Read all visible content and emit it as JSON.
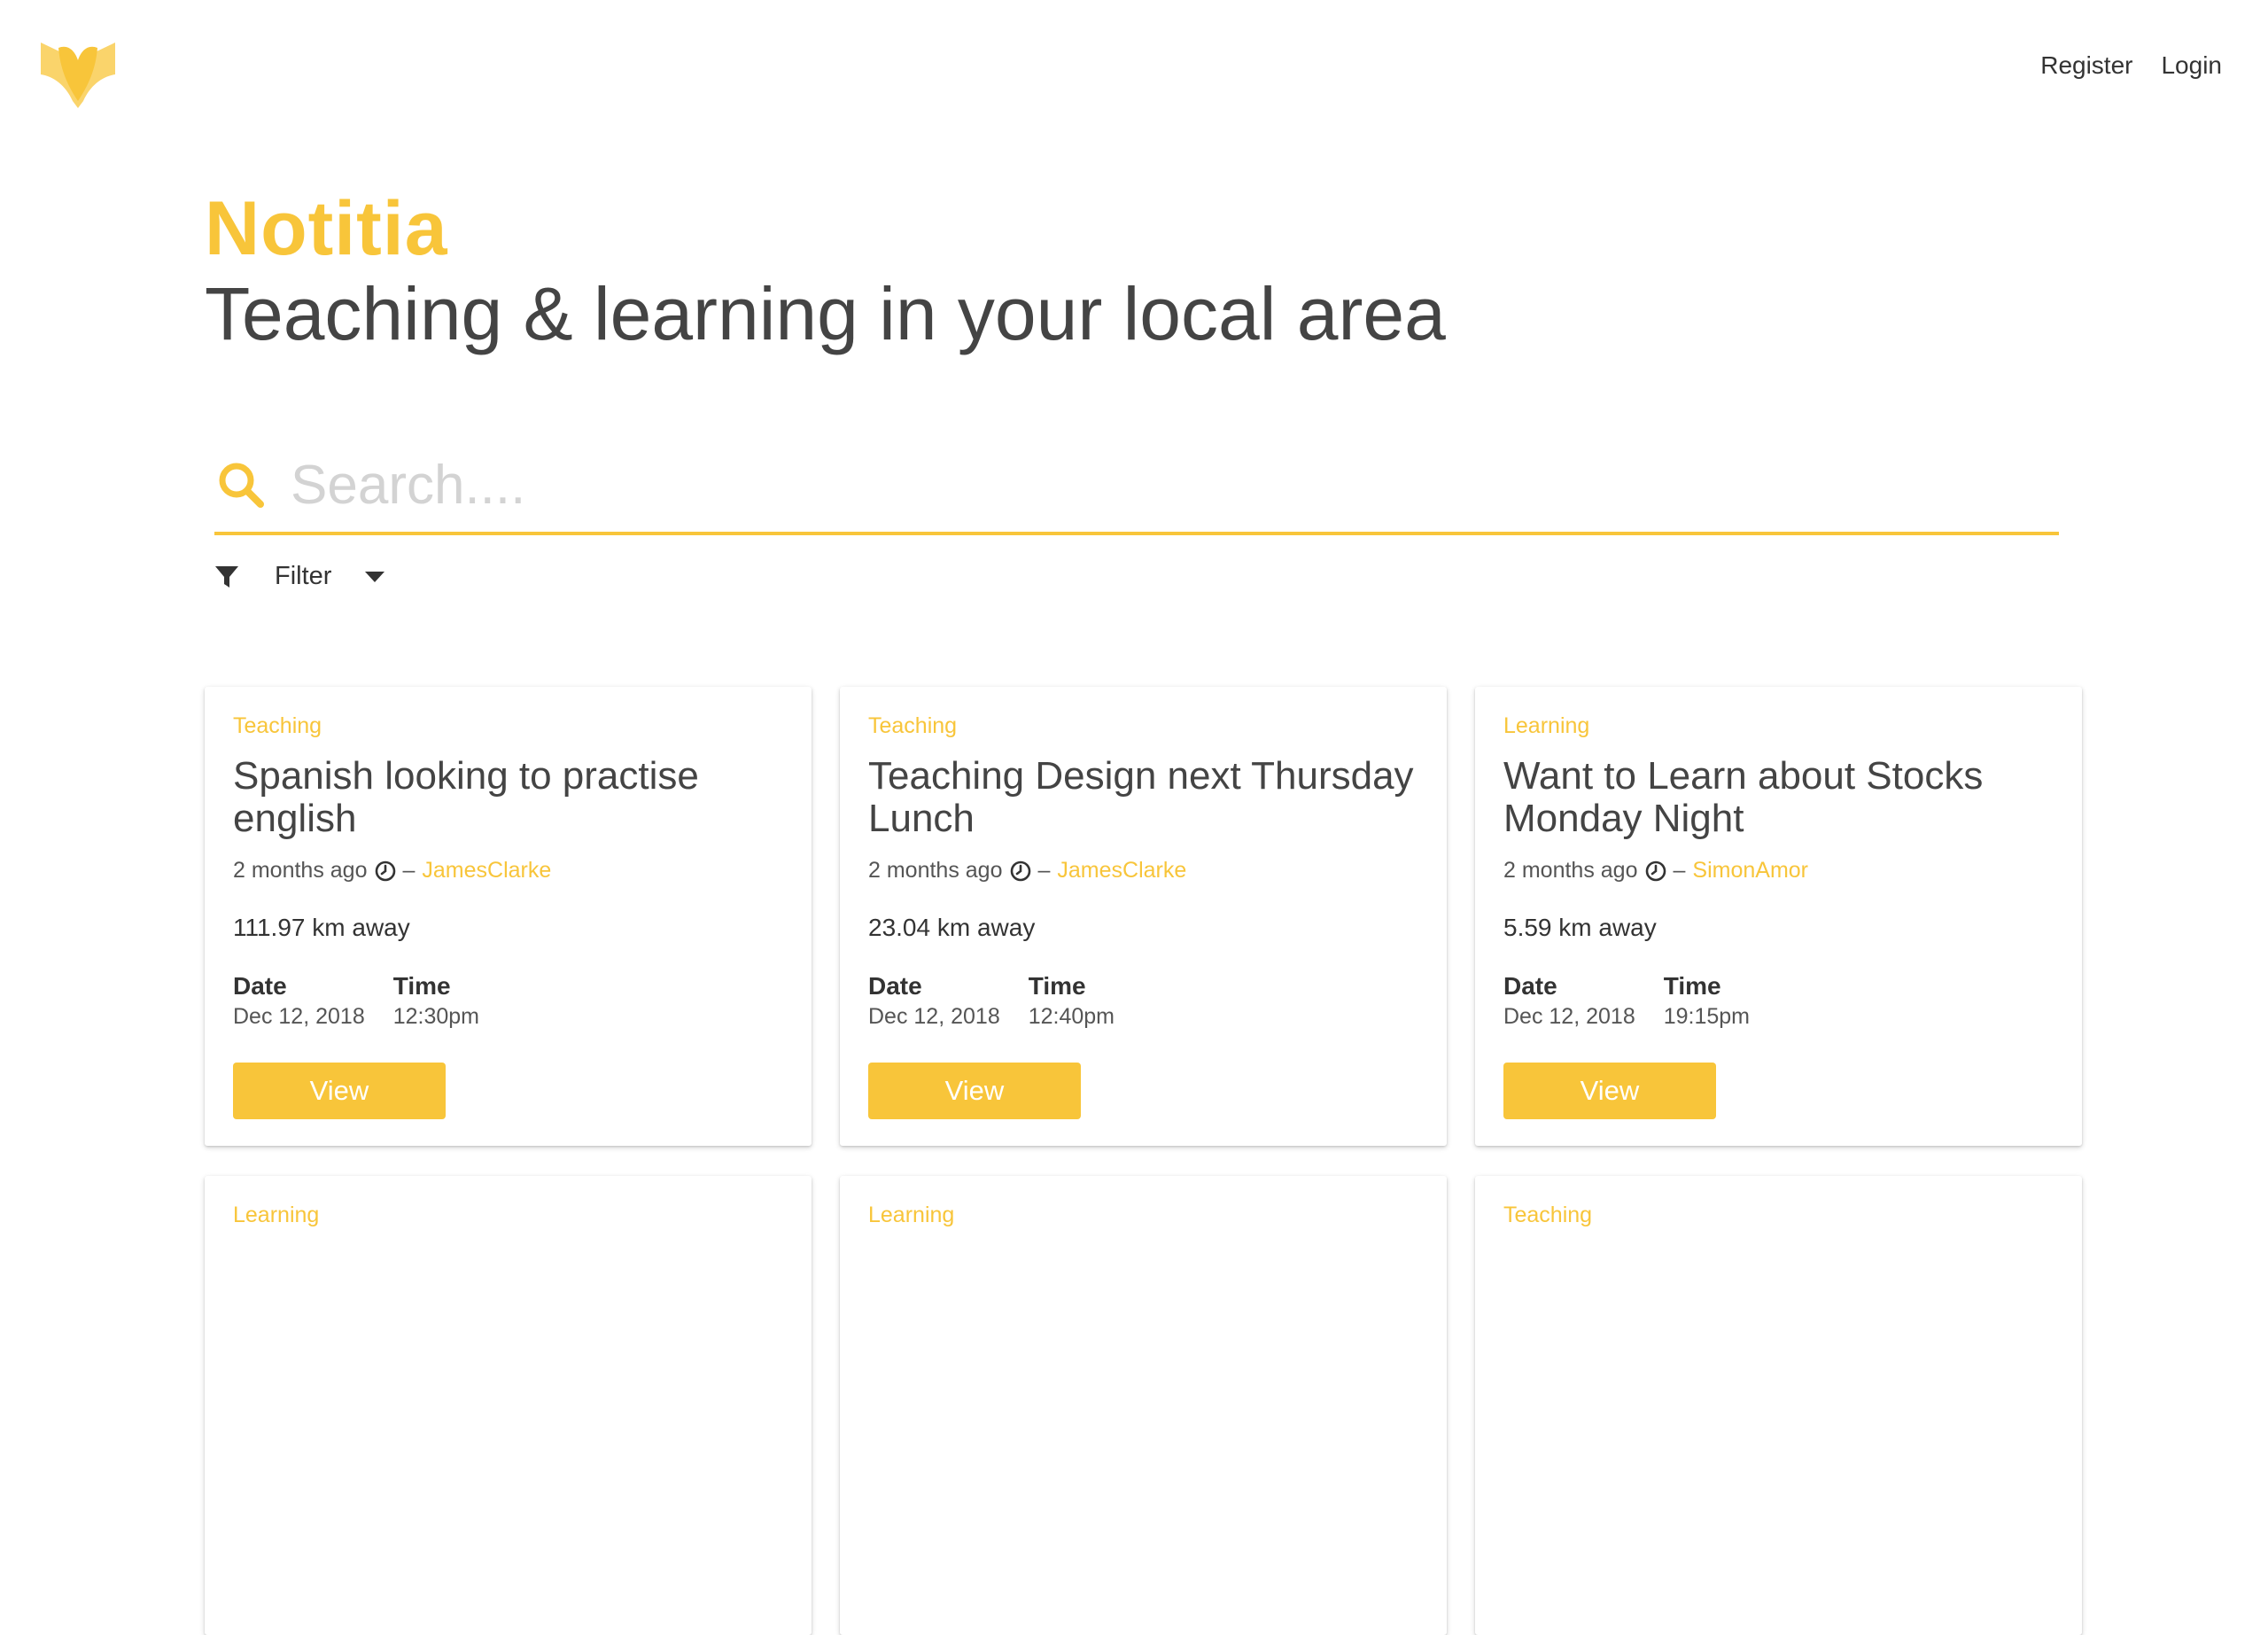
{
  "colors": {
    "accent": "#f8c53a",
    "text": "#444444",
    "placeholder": "#d3d3d3"
  },
  "header": {
    "logo": "book-logo-icon",
    "nav": [
      {
        "label": "Register"
      },
      {
        "label": "Login"
      }
    ]
  },
  "hero": {
    "brand": "Notitia",
    "tagline": "Teaching & learning in your local area"
  },
  "search": {
    "icon": "search-icon",
    "placeholder": "Search....",
    "value": ""
  },
  "filter": {
    "icon": "funnel-icon",
    "label": "Filter",
    "caret": "caret-down-icon"
  },
  "cards": [
    {
      "category": "Teaching",
      "title": "Spanish looking to practise english",
      "posted": "2 months ago",
      "author": "JamesClarke",
      "distance": "111.97 km away",
      "date_label": "Date",
      "date": "Dec 12, 2018",
      "time_label": "Time",
      "time": "12:30pm",
      "button": "View"
    },
    {
      "category": "Teaching",
      "title": "Teaching Design next Thursday Lunch",
      "posted": "2 months ago",
      "author": "JamesClarke",
      "distance": "23.04 km away",
      "date_label": "Date",
      "date": "Dec 12, 2018",
      "time_label": "Time",
      "time": "12:40pm",
      "button": "View"
    },
    {
      "category": "Learning",
      "title": "Want to Learn about Stocks Monday Night",
      "posted": "2 months ago",
      "author": "SimonAmor",
      "distance": "5.59 km away",
      "date_label": "Date",
      "date": "Dec 12, 2018",
      "time_label": "Time",
      "time": "19:15pm",
      "button": "View"
    },
    {
      "category": "Learning"
    },
    {
      "category": "Learning"
    },
    {
      "category": "Teaching"
    }
  ]
}
